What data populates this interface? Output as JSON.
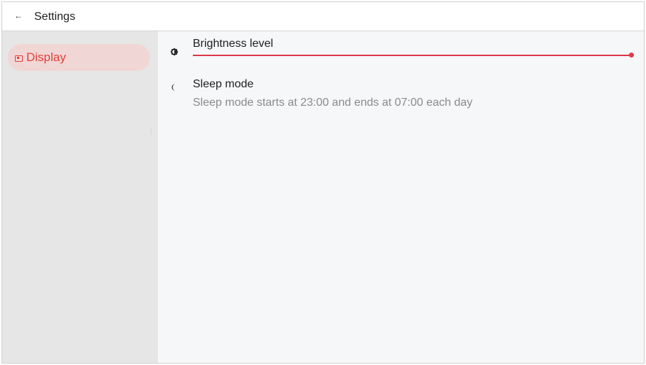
{
  "header": {
    "back_icon": "arrow-left-icon",
    "back_glyph": "←",
    "title": "Settings"
  },
  "sidebar": {
    "items": [
      {
        "label": "Display",
        "icon": "display-icon",
        "selected": true
      }
    ]
  },
  "main": {
    "brightness": {
      "icon": "brightness-icon",
      "label": "Brightness level",
      "value_fraction": 1.0
    },
    "sleep": {
      "icon": "moon-icon",
      "label": "Sleep mode",
      "description": "Sleep mode starts at 23:00 and ends at 07:00 each day"
    }
  },
  "colors": {
    "accent": "#e2403a",
    "selected_bg": "#f1d6d6",
    "slider": "#d83848",
    "sidebar_bg": "#e6e6e6",
    "content_bg": "#f6f7f9"
  }
}
